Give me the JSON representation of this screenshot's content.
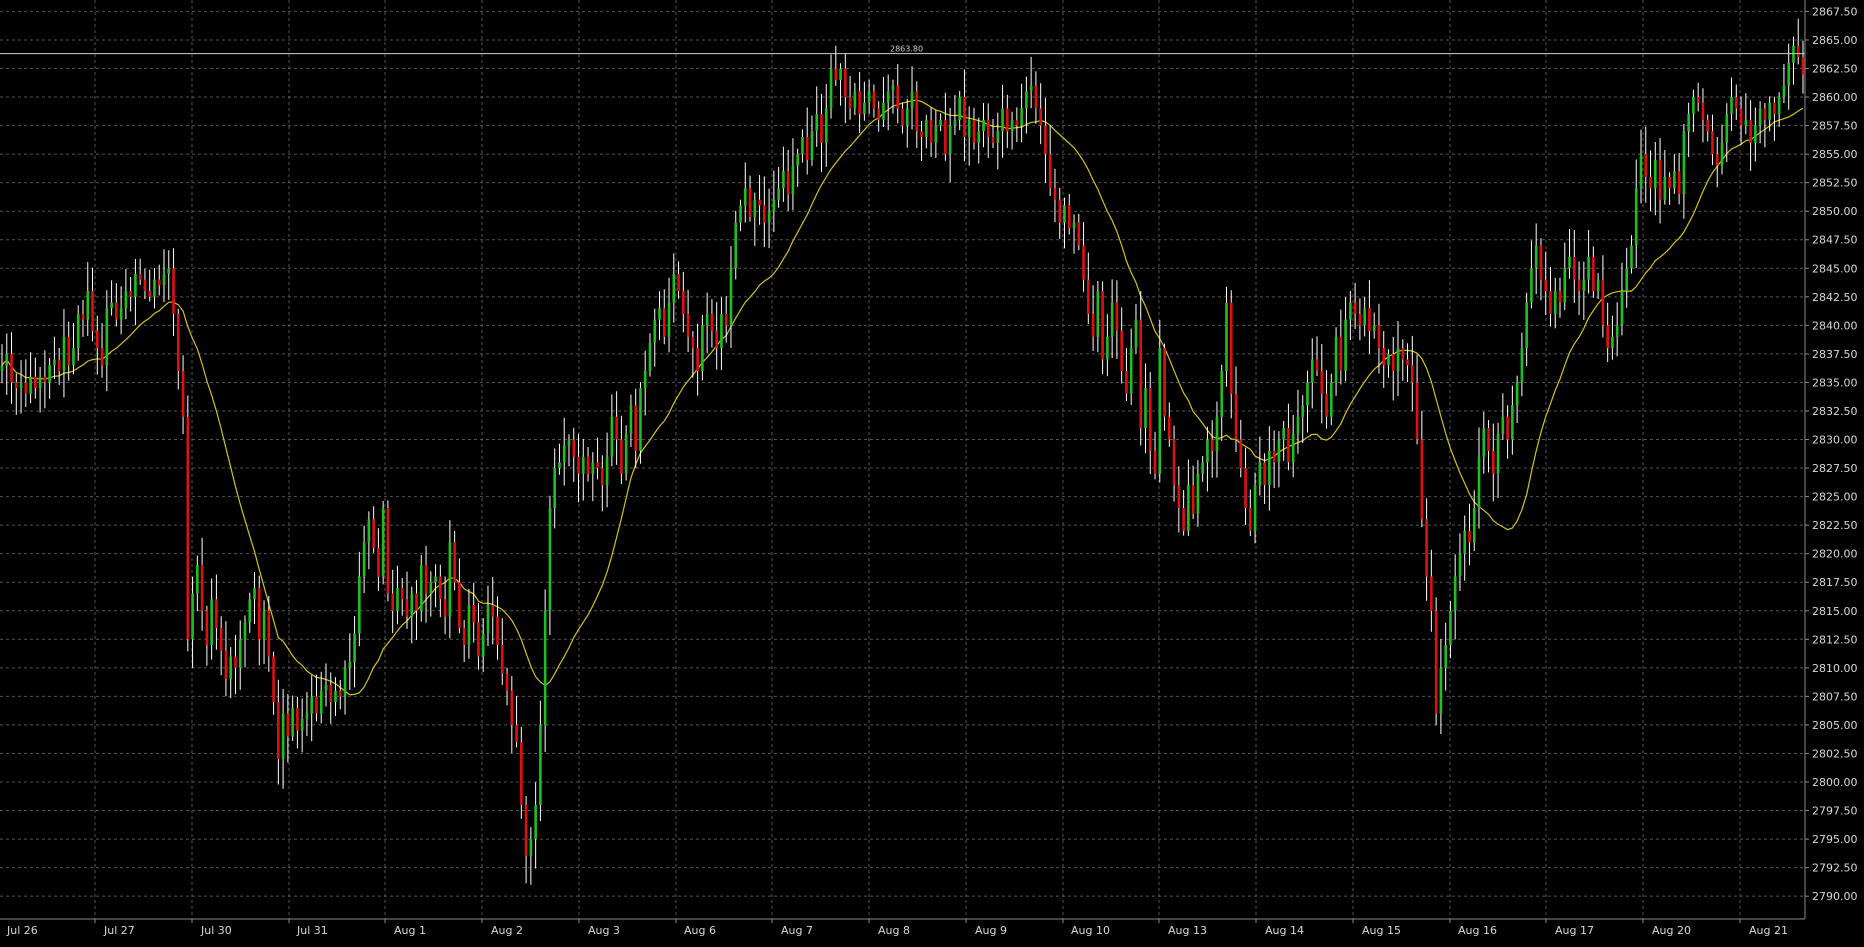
{
  "chart_data": {
    "type": "candlestick",
    "title": "",
    "xlabel": "",
    "ylabel": "",
    "ylim": [
      2788.0,
      2868.5
    ],
    "y_ticks": [
      2790.0,
      2792.5,
      2795.0,
      2797.5,
      2800.0,
      2802.5,
      2805.0,
      2807.5,
      2810.0,
      2812.5,
      2815.0,
      2817.5,
      2820.0,
      2822.5,
      2825.0,
      2827.5,
      2830.0,
      2832.5,
      2835.0,
      2837.5,
      2840.0,
      2842.5,
      2845.0,
      2847.5,
      2850.0,
      2852.5,
      2855.0,
      2857.5,
      2860.0,
      2862.5,
      2865.0,
      2867.5
    ],
    "y_tick_labels": [
      "2790.00",
      "2792.50",
      "2795.00",
      "2797.50",
      "2800.00",
      "2802.50",
      "2805.00",
      "2807.50",
      "2810.00",
      "2812.50",
      "2815.00",
      "2817.50",
      "2820.00",
      "2822.50",
      "2825.00",
      "2827.50",
      "2830.00",
      "2832.50",
      "2835.00",
      "2837.50",
      "2840.00",
      "2842.50",
      "2845.00",
      "2847.50",
      "2850.00",
      "2852.50",
      "2855.00",
      "2857.50",
      "2860.00",
      "2862.50",
      "2865.00",
      "2867.50"
    ],
    "x_tick_labels": [
      "Jul 26",
      "Jul 27",
      "Jul 30",
      "Jul 31",
      "Aug 1",
      "Aug 2",
      "Aug 3",
      "Aug 6",
      "Aug 7",
      "Aug 8",
      "Aug 9",
      "Aug 10",
      "Aug 13",
      "Aug 14",
      "Aug 15",
      "Aug 16",
      "Aug 17",
      "Aug 20",
      "Aug 21"
    ],
    "grid": true,
    "up_color": "#1fbf1f",
    "down_color": "#e01010",
    "wick_color": "#ffffff",
    "ma_color": "#d4c21a",
    "ref_line": {
      "value": 2863.8,
      "label": "2863.80",
      "color": "#cfcfcf"
    },
    "background": "#000000",
    "grid_color": "#555555",
    "axis_color": "#8a8a8a",
    "closes": [
      2836.5,
      2837.5,
      2835.0,
      2834.5,
      2835.0,
      2834.0,
      2835.5,
      2834.5,
      2835.5,
      2835.0,
      2836.5,
      2837.0,
      2836.0,
      2839.0,
      2836.5,
      2838.0,
      2841.0,
      2840.5,
      2843.0,
      2839.5,
      2838.0,
      2836.5,
      2841.5,
      2842.0,
      2840.5,
      2841.5,
      2843.0,
      2842.5,
      2844.5,
      2844.0,
      2843.0,
      2842.5,
      2844.0,
      2843.5,
      2844.5,
      2845.0,
      2841.0,
      2836.0,
      2832.0,
      2812.5,
      2816.5,
      2819.0,
      2815.0,
      2812.0,
      2816.0,
      2813.5,
      2811.5,
      2809.0,
      2811.0,
      2810.0,
      2812.5,
      2814.0,
      2816.0,
      2817.0,
      2812.5,
      2815.0,
      2811.0,
      2807.0,
      2802.0,
      2806.0,
      2804.0,
      2806.5,
      2804.5,
      2805.5,
      2806.0,
      2807.5,
      2806.0,
      2808.0,
      2808.5,
      2807.0,
      2808.0,
      2807.5,
      2810.0,
      2810.5,
      2813.0,
      2818.0,
      2821.0,
      2823.0,
      2820.5,
      2818.0,
      2824.0,
      2816.5,
      2815.0,
      2817.0,
      2816.0,
      2814.5,
      2816.5,
      2815.0,
      2819.0,
      2816.5,
      2817.5,
      2818.0,
      2816.0,
      2814.5,
      2821.0,
      2817.5,
      2813.5,
      2812.0,
      2815.5,
      2814.0,
      2811.0,
      2813.0,
      2815.5,
      2814.5,
      2812.0,
      2809.5,
      2808.0,
      2805.0,
      2803.5,
      2798.0,
      2793.5,
      2795.0,
      2798.0,
      2805.0,
      2815.0,
      2824.0,
      2827.5,
      2828.0,
      2829.5,
      2830.0,
      2828.5,
      2827.0,
      2828.5,
      2827.0,
      2828.0,
      2827.5,
      2826.0,
      2828.5,
      2832.0,
      2830.0,
      2827.0,
      2830.5,
      2833.0,
      2829.0,
      2834.5,
      2836.0,
      2838.5,
      2840.5,
      2841.5,
      2839.0,
      2842.0,
      2844.5,
      2843.0,
      2841.0,
      2839.0,
      2838.0,
      2836.0,
      2840.0,
      2841.0,
      2839.5,
      2838.0,
      2841.0,
      2840.0,
      2845.0,
      2849.0,
      2850.5,
      2852.0,
      2849.5,
      2851.0,
      2850.5,
      2849.0,
      2850.0,
      2851.0,
      2852.0,
      2853.5,
      2851.5,
      2854.0,
      2855.0,
      2856.5,
      2854.5,
      2857.0,
      2858.5,
      2856.0,
      2859.0,
      2862.5,
      2861.5,
      2862.5,
      2860.0,
      2859.0,
      2860.5,
      2858.5,
      2859.5,
      2860.5,
      2859.0,
      2858.0,
      2859.5,
      2860.5,
      2861.0,
      2859.0,
      2857.5,
      2859.0,
      2860.5,
      2857.0,
      2856.5,
      2858.0,
      2856.0,
      2857.5,
      2858.0,
      2855.0,
      2857.5,
      2858.0,
      2860.0,
      2856.5,
      2858.0,
      2856.0,
      2857.0,
      2858.0,
      2856.5,
      2856.0,
      2857.0,
      2859.0,
      2857.0,
      2858.0,
      2857.5,
      2859.0,
      2860.5,
      2861.0,
      2859.0,
      2857.5,
      2855.0,
      2852.0,
      2851.0,
      2849.0,
      2850.5,
      2848.5,
      2849.0,
      2847.0,
      2844.0,
      2841.0,
      2839.0,
      2843.0,
      2837.0,
      2839.0,
      2842.0,
      2839.5,
      2836.0,
      2834.0,
      2838.0,
      2840.5,
      2831.0,
      2834.5,
      2829.0,
      2827.0,
      2838.0,
      2832.0,
      2830.0,
      2826.0,
      2824.0,
      2822.0,
      2826.0,
      2823.5,
      2827.0,
      2828.0,
      2830.0,
      2829.0,
      2832.0,
      2836.0,
      2842.0,
      2834.0,
      2830.0,
      2827.5,
      2824.0,
      2822.0,
      2826.0,
      2828.0,
      2826.0,
      2829.0,
      2828.0,
      2830.0,
      2831.0,
      2828.0,
      2830.5,
      2832.0,
      2833.0,
      2835.0,
      2837.0,
      2836.0,
      2834.0,
      2832.0,
      2835.0,
      2839.0,
      2836.0,
      2840.5,
      2842.0,
      2841.0,
      2840.0,
      2841.5,
      2839.5,
      2840.0,
      2838.0,
      2836.5,
      2837.5,
      2836.0,
      2838.0,
      2837.0,
      2836.5,
      2835.0,
      2830.0,
      2823.0,
      2818.0,
      2815.0,
      2806.0,
      2810.0,
      2812.0,
      2815.0,
      2818.0,
      2820.0,
      2822.0,
      2821.0,
      2824.0,
      2828.5,
      2831.0,
      2829.0,
      2827.0,
      2830.5,
      2832.0,
      2830.0,
      2833.0,
      2835.0,
      2838.0,
      2842.0,
      2845.0,
      2847.0,
      2844.0,
      2843.0,
      2841.0,
      2843.0,
      2842.0,
      2845.0,
      2846.0,
      2844.0,
      2843.0,
      2844.0,
      2846.0,
      2843.0,
      2844.0,
      2840.0,
      2838.0,
      2839.0,
      2840.0,
      2843.0,
      2845.0,
      2847.0,
      2852.0,
      2855.0,
      2853.0,
      2852.0,
      2854.5,
      2851.0,
      2853.0,
      2852.0,
      2853.5,
      2851.5,
      2857.0,
      2858.5,
      2860.0,
      2859.5,
      2858.0,
      2857.0,
      2855.0,
      2854.0,
      2856.0,
      2858.5,
      2860.0,
      2859.0,
      2857.5,
      2858.0,
      2856.0,
      2857.5,
      2859.0,
      2858.0,
      2859.5,
      2858.5,
      2860.0,
      2861.0,
      2863.0,
      2864.5,
      2863.5,
      2862.0
    ]
  }
}
